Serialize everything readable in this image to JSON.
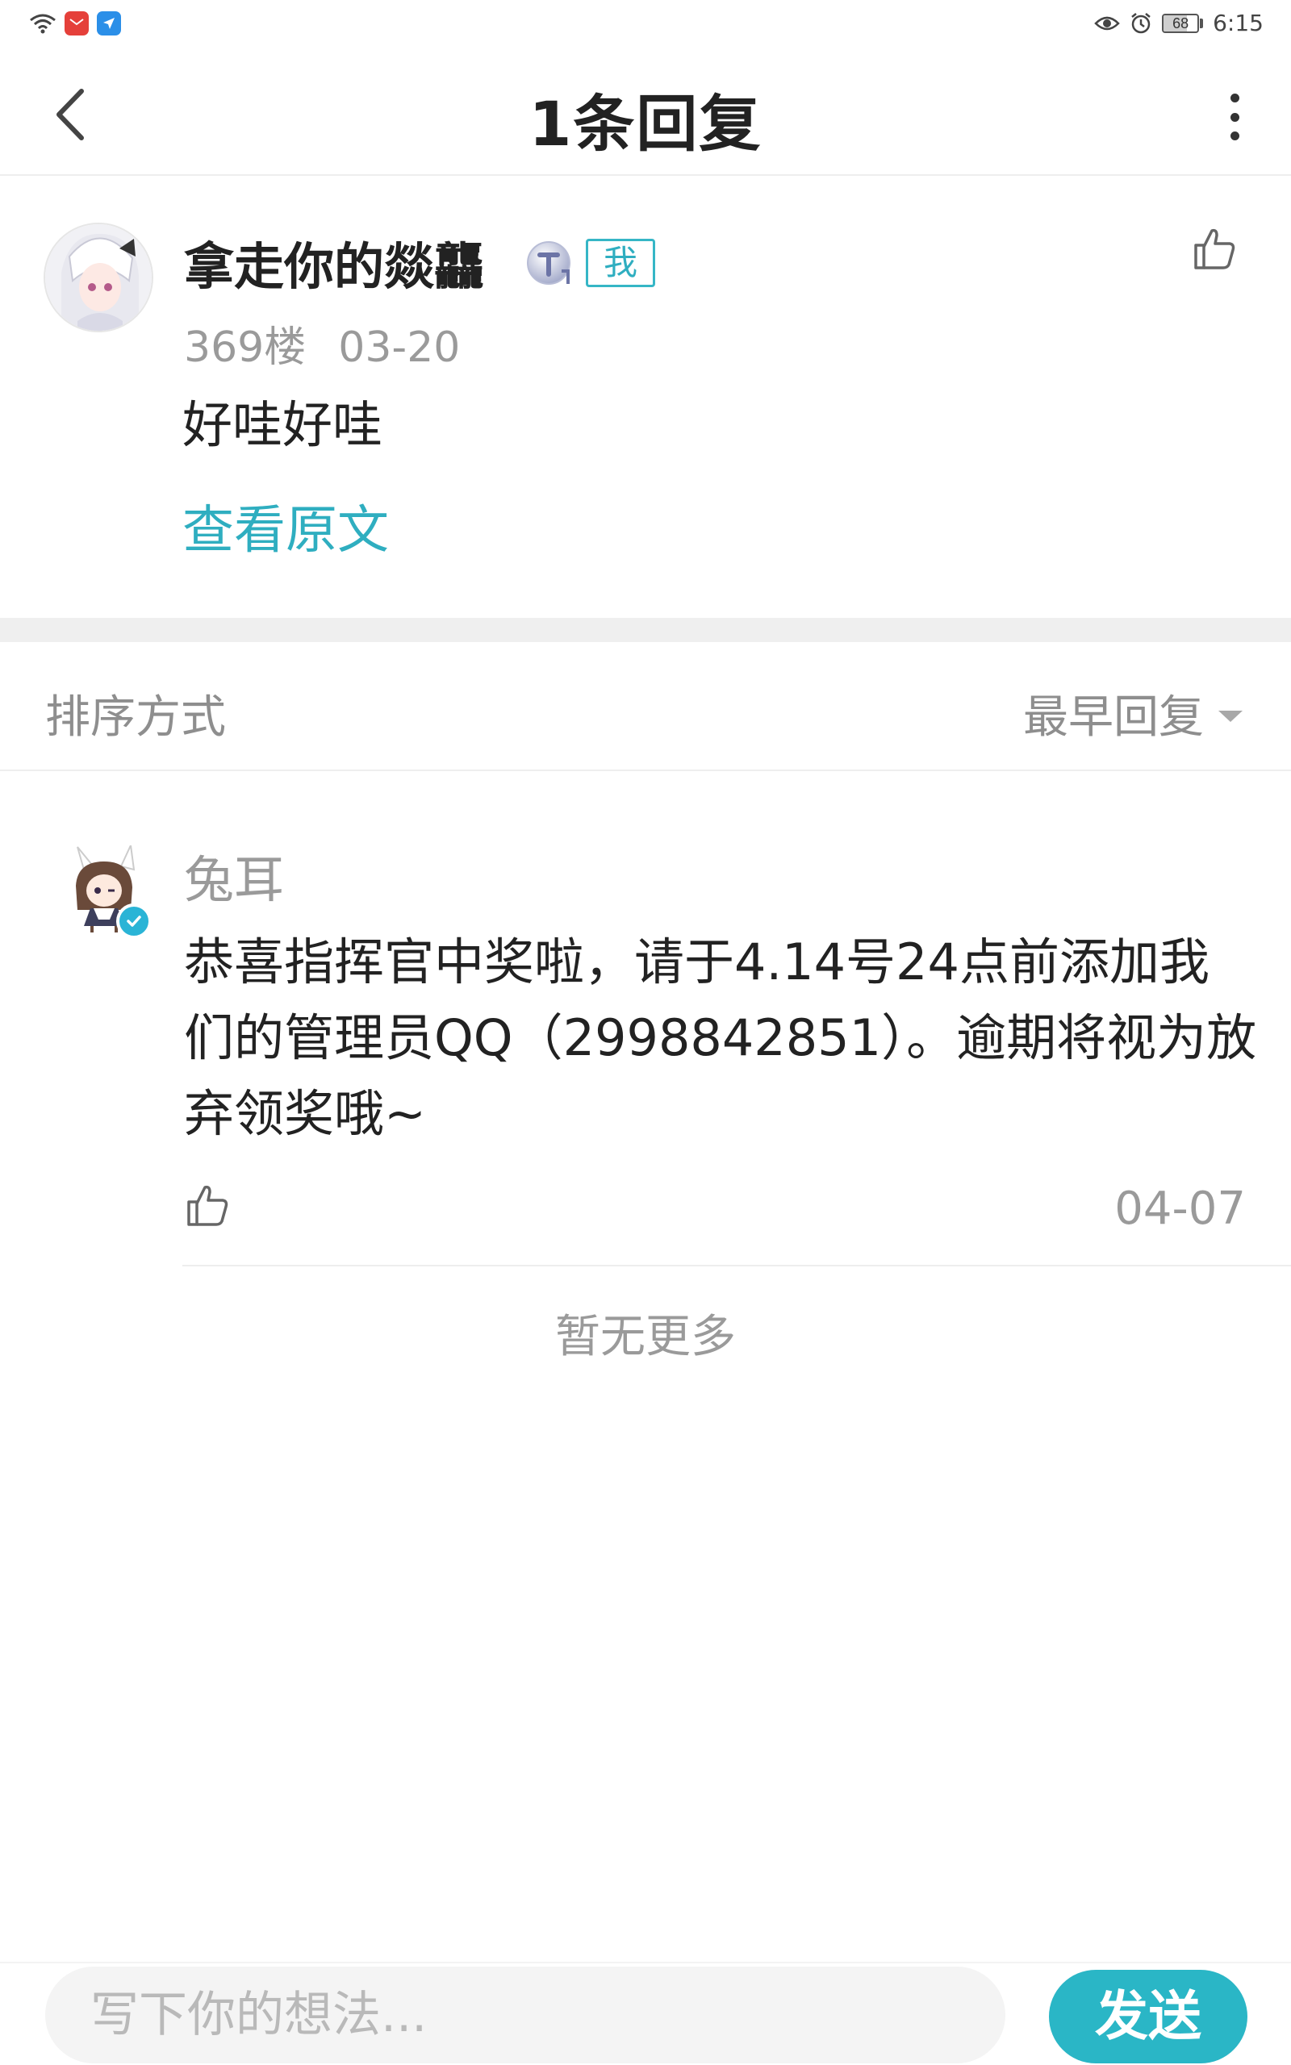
{
  "status_bar": {
    "time": "6:15",
    "battery_level": "68",
    "battery_fraction": 0.68,
    "icons": [
      "wifi-icon",
      "huawei-app-icon",
      "messenger-app-icon",
      "eye-icon",
      "alarm-icon",
      "battery-icon"
    ]
  },
  "header": {
    "title": "1条回复",
    "back_icon": "chevron-left-icon",
    "more_icon": "more-vertical-icon"
  },
  "post": {
    "username": "拿走你的燚龘",
    "me_badge": "我",
    "floor": "369楼",
    "date": "03-20",
    "content": "好哇好哇",
    "view_original": "查看原文",
    "like_icon": "thumbs-up-icon"
  },
  "sort": {
    "label": "排序方式",
    "selected": "最早回复"
  },
  "reply": {
    "username": "兔耳",
    "text": "恭喜指挥官中奖啦，请于4.14号24点前添加我们的管理员QQ（2998842851）。逾期将视为放弃领奖哦~",
    "date": "04-07",
    "like_icon": "thumbs-up-icon",
    "verified_icon": "verified-check-icon"
  },
  "footer_note": "暂无更多",
  "composer": {
    "placeholder": "写下你的想法...",
    "send_label": "发送"
  },
  "colors": {
    "accent": "#2ab6c6",
    "text_primary": "#222222",
    "text_secondary": "#9a9a9a",
    "section_gap": "#efefef"
  }
}
